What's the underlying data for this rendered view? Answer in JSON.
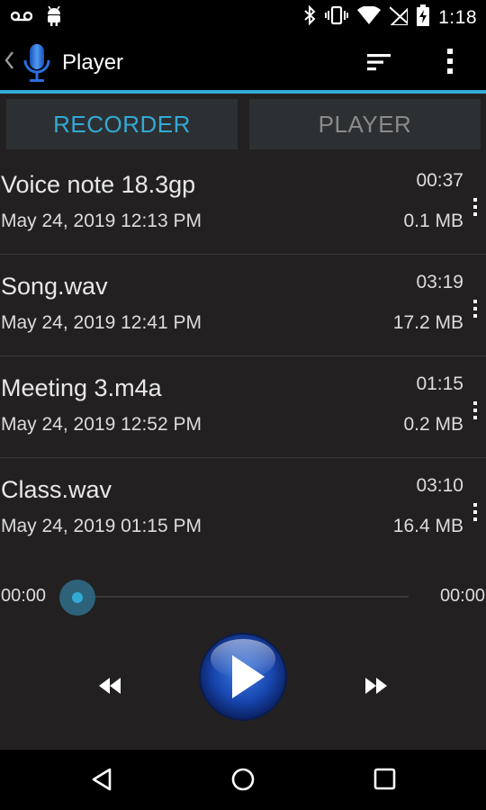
{
  "status_bar": {
    "time": "1:18",
    "icons": [
      "voicemail-icon",
      "android-debug-icon",
      "bluetooth-icon",
      "vibrate-icon",
      "wifi-icon",
      "no-sim-icon",
      "battery-charging-icon"
    ]
  },
  "action_bar": {
    "title": "Player",
    "icons": [
      "back-caret-icon",
      "microphone-app-icon",
      "sort-icon",
      "overflow-menu-icon"
    ]
  },
  "tabs": [
    {
      "label": "RECORDER",
      "active": true
    },
    {
      "label": "PLAYER",
      "active": false
    }
  ],
  "recordings": [
    {
      "name": "Voice note 18.3gp",
      "date": "May 24, 2019 12:13 PM",
      "duration": "00:37",
      "size": "0.1 MB"
    },
    {
      "name": "Song.wav",
      "date": "May 24, 2019 12:41 PM",
      "duration": "03:19",
      "size": "17.2 MB"
    },
    {
      "name": "Meeting 3.m4a",
      "date": "May 24, 2019 12:52 PM",
      "duration": "01:15",
      "size": "0.2 MB"
    },
    {
      "name": "Class.wav",
      "date": "May 24, 2019 01:15 PM",
      "duration": "03:10",
      "size": "16.4 MB"
    }
  ],
  "player": {
    "elapsed": "00:00",
    "total": "00:00",
    "progress": 0
  },
  "colors": {
    "accent": "#33a9d6",
    "background": "#232021",
    "tab_background": "#2c3032",
    "inactive_tab_text": "#8a8a8a"
  }
}
